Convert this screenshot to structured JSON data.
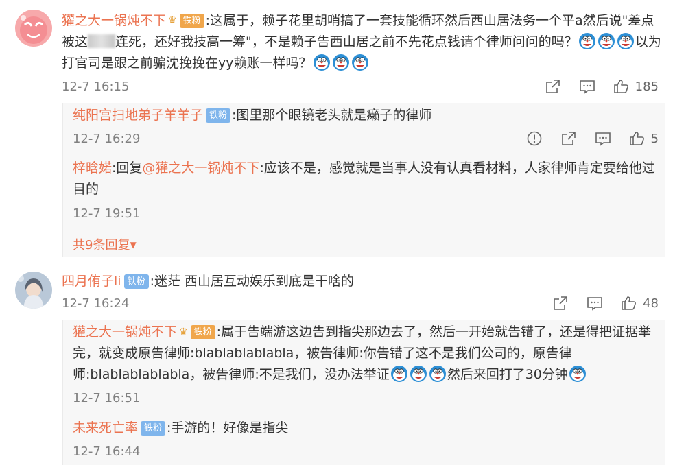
{
  "comments": [
    {
      "user": "獾之大一锅炖不下",
      "badge": "铁粉",
      "crown": "♛",
      "text_line1_pre": ":这属于，赖子花里胡哨搞了一套技能循环然后西山居法务一个平a然后说\"差点",
      "text_line2_pre": "被这",
      "text_line2_post": "连死，还好我技高一筹\"，不是赖子告西山居之前不先花点钱请个律师问问的吗？",
      "text_line2_tail": "以为",
      "text_line3": "打官司是跟之前骗沈挽挽在yy赖账一样吗？",
      "time": "12-7 16:15",
      "likes": "185"
    },
    {
      "user": "四月侑子li",
      "badge": "铁粉",
      "text": ":迷茫 西山居互动娱乐到底是干啥的",
      "time": "12-7 16:24",
      "likes": "48"
    }
  ],
  "replies_a": [
    {
      "user": "纯阳宫扫地弟子羊羊子",
      "badge": "铁粉",
      "text": ":图里那个眼镜老头就是癞子的律师",
      "time": "12-7 16:29",
      "likes": "5"
    },
    {
      "user": "梓晗婼",
      "reply_prefix": ":回复",
      "mention": "@獾之大一锅炖不下",
      "text_line1": ":应该不是，感觉就是当事人没有认真看材料，人家律师肯定要给他过",
      "text_line2": "目的",
      "time": "12-7 19:51"
    }
  ],
  "more_replies": "共9条回复",
  "replies_b": [
    {
      "user": "獾之大一锅炖不下",
      "badge": "铁粉",
      "crown": "♛",
      "text_line1": ":属于告端游这边告到指尖那边去了，然后一开始就告错了，还是得把证据举",
      "text_line2": "完，就变成原告律师:blablablablabla，被告律师:你告错了这不是我们公司的，原告律",
      "text_line3_pre": "师:blablablablabla，被告律师:不是我们，没办法举证",
      "text_line3_post": "然后来回打了30分钟",
      "time": "12-7 16:51"
    },
    {
      "user": "未来死亡率",
      "badge": "铁粉",
      "text": ":手游的！好像是指尖",
      "time": "12-7 16:44"
    }
  ],
  "icons": [
    "share-icon",
    "comment-icon",
    "like-icon",
    "report-icon",
    "doraemon-emoji-icon"
  ],
  "colors": {
    "username": "#eb7350",
    "badge": "#7fb5ec",
    "meta": "#808080",
    "panel": "#f7f7f7"
  }
}
